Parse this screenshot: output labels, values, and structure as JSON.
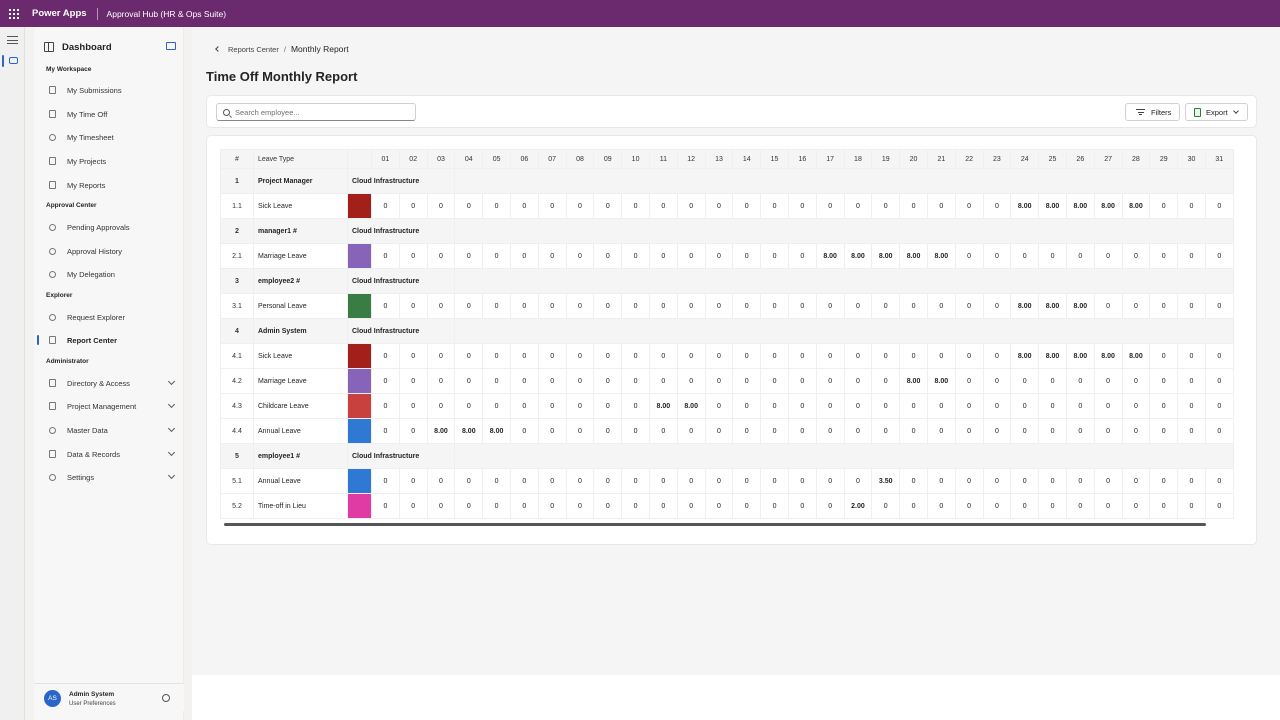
{
  "topbar": {
    "brand": "Power Apps",
    "app_title": "Approval Hub (HR & Ops Suite)"
  },
  "sidebar": {
    "dashboard_label": "Dashboard",
    "sections": {
      "my_workspace": "My Workspace",
      "approval_center": "Approval Center",
      "explorer": "Explorer",
      "administrator": "Administrator"
    },
    "items": {
      "my_submissions": "My Submissions",
      "my_time_off": "My Time Off",
      "my_timesheet": "My Timesheet",
      "my_projects": "My Projects",
      "my_reports": "My Reports",
      "pending_approvals": "Pending Approvals",
      "approval_history": "Approval History",
      "my_delegation": "My Delegation",
      "request_explorer": "Request Explorer",
      "report_center": "Report Center",
      "directory_access": "Directory & Access",
      "project_management": "Project Management",
      "master_data": "Master Data",
      "data_records": "Data & Records",
      "settings": "Settings"
    },
    "user": {
      "initials": "AS",
      "name": "Admin System",
      "preferences": "User Preferences"
    }
  },
  "breadcrumb": {
    "parent": "Reports Center",
    "separator": "/",
    "current": "Monthly Report"
  },
  "page_title": "Time Off Monthly Report",
  "toolbar": {
    "search_placeholder": "Search employee...",
    "filters_label": "Filters",
    "export_label": "Export"
  },
  "table": {
    "col_index": "#",
    "col_leave_type": "Leave Type",
    "days": [
      "01",
      "02",
      "03",
      "04",
      "05",
      "06",
      "07",
      "08",
      "09",
      "10",
      "11",
      "12",
      "13",
      "14",
      "15",
      "16",
      "17",
      "18",
      "19",
      "20",
      "21",
      "22",
      "23",
      "24",
      "25",
      "26",
      "27",
      "28",
      "29",
      "30",
      "31"
    ],
    "groups": [
      {
        "index": "1",
        "name": "Project Manager",
        "department": "Cloud Infrastructure",
        "items": [
          {
            "index": "1.1",
            "leave_type": "Sick Leave",
            "color": "#a31f1a",
            "values": [
              "0",
              "0",
              "0",
              "0",
              "0",
              "0",
              "0",
              "0",
              "0",
              "0",
              "0",
              "0",
              "0",
              "0",
              "0",
              "0",
              "0",
              "0",
              "0",
              "0",
              "0",
              "0",
              "0",
              "8.00",
              "8.00",
              "8.00",
              "8.00",
              "8.00",
              "0",
              "0",
              "0"
            ]
          }
        ]
      },
      {
        "index": "2",
        "name": "manager1 #",
        "department": "Cloud Infrastructure",
        "items": [
          {
            "index": "2.1",
            "leave_type": "Marriage Leave",
            "color": "#8764b8",
            "values": [
              "0",
              "0",
              "0",
              "0",
              "0",
              "0",
              "0",
              "0",
              "0",
              "0",
              "0",
              "0",
              "0",
              "0",
              "0",
              "0",
              "8.00",
              "8.00",
              "8.00",
              "8.00",
              "8.00",
              "0",
              "0",
              "0",
              "0",
              "0",
              "0",
              "0",
              "0",
              "0",
              "0"
            ]
          }
        ]
      },
      {
        "index": "3",
        "name": "employee2 #",
        "department": "Cloud Infrastructure",
        "items": [
          {
            "index": "3.1",
            "leave_type": "Personal Leave",
            "color": "#3a7d44",
            "values": [
              "0",
              "0",
              "0",
              "0",
              "0",
              "0",
              "0",
              "0",
              "0",
              "0",
              "0",
              "0",
              "0",
              "0",
              "0",
              "0",
              "0",
              "0",
              "0",
              "0",
              "0",
              "0",
              "0",
              "8.00",
              "8.00",
              "8.00",
              "0",
              "0",
              "0",
              "0",
              "0"
            ]
          }
        ]
      },
      {
        "index": "4",
        "name": "Admin System",
        "department": "Cloud Infrastructure",
        "items": [
          {
            "index": "4.1",
            "leave_type": "Sick Leave",
            "color": "#a31f1a",
            "values": [
              "0",
              "0",
              "0",
              "0",
              "0",
              "0",
              "0",
              "0",
              "0",
              "0",
              "0",
              "0",
              "0",
              "0",
              "0",
              "0",
              "0",
              "0",
              "0",
              "0",
              "0",
              "0",
              "0",
              "8.00",
              "8.00",
              "8.00",
              "8.00",
              "8.00",
              "0",
              "0",
              "0"
            ]
          },
          {
            "index": "4.2",
            "leave_type": "Marriage Leave",
            "color": "#8764b8",
            "values": [
              "0",
              "0",
              "0",
              "0",
              "0",
              "0",
              "0",
              "0",
              "0",
              "0",
              "0",
              "0",
              "0",
              "0",
              "0",
              "0",
              "0",
              "0",
              "0",
              "8.00",
              "8.00",
              "0",
              "0",
              "0",
              "0",
              "0",
              "0",
              "0",
              "0",
              "0",
              "0"
            ]
          },
          {
            "index": "4.3",
            "leave_type": "Childcare Leave",
            "color": "#c8413f",
            "values": [
              "0",
              "0",
              "0",
              "0",
              "0",
              "0",
              "0",
              "0",
              "0",
              "0",
              "8.00",
              "8.00",
              "0",
              "0",
              "0",
              "0",
              "0",
              "0",
              "0",
              "0",
              "0",
              "0",
              "0",
              "0",
              "0",
              "0",
              "0",
              "0",
              "0",
              "0",
              "0"
            ]
          },
          {
            "index": "4.4",
            "leave_type": "Annual Leave",
            "color": "#2f78d4",
            "values": [
              "0",
              "0",
              "8.00",
              "8.00",
              "8.00",
              "0",
              "0",
              "0",
              "0",
              "0",
              "0",
              "0",
              "0",
              "0",
              "0",
              "0",
              "0",
              "0",
              "0",
              "0",
              "0",
              "0",
              "0",
              "0",
              "0",
              "0",
              "0",
              "0",
              "0",
              "0",
              "0"
            ]
          }
        ]
      },
      {
        "index": "5",
        "name": "employee1 #",
        "department": "Cloud Infrastructure",
        "items": [
          {
            "index": "5.1",
            "leave_type": "Annual Leave",
            "color": "#2f78d4",
            "values": [
              "0",
              "0",
              "0",
              "0",
              "0",
              "0",
              "0",
              "0",
              "0",
              "0",
              "0",
              "0",
              "0",
              "0",
              "0",
              "0",
              "0",
              "0",
              "3.50",
              "0",
              "0",
              "0",
              "0",
              "0",
              "0",
              "0",
              "0",
              "0",
              "0",
              "0",
              "0"
            ]
          },
          {
            "index": "5.2",
            "leave_type": "Time-off in Lieu",
            "color": "#e03aa5",
            "values": [
              "0",
              "0",
              "0",
              "0",
              "0",
              "0",
              "0",
              "0",
              "0",
              "0",
              "0",
              "0",
              "0",
              "0",
              "0",
              "0",
              "0",
              "2.00",
              "0",
              "0",
              "0",
              "0",
              "0",
              "0",
              "0",
              "0",
              "0",
              "0",
              "0",
              "0",
              "0"
            ]
          }
        ]
      }
    ]
  }
}
